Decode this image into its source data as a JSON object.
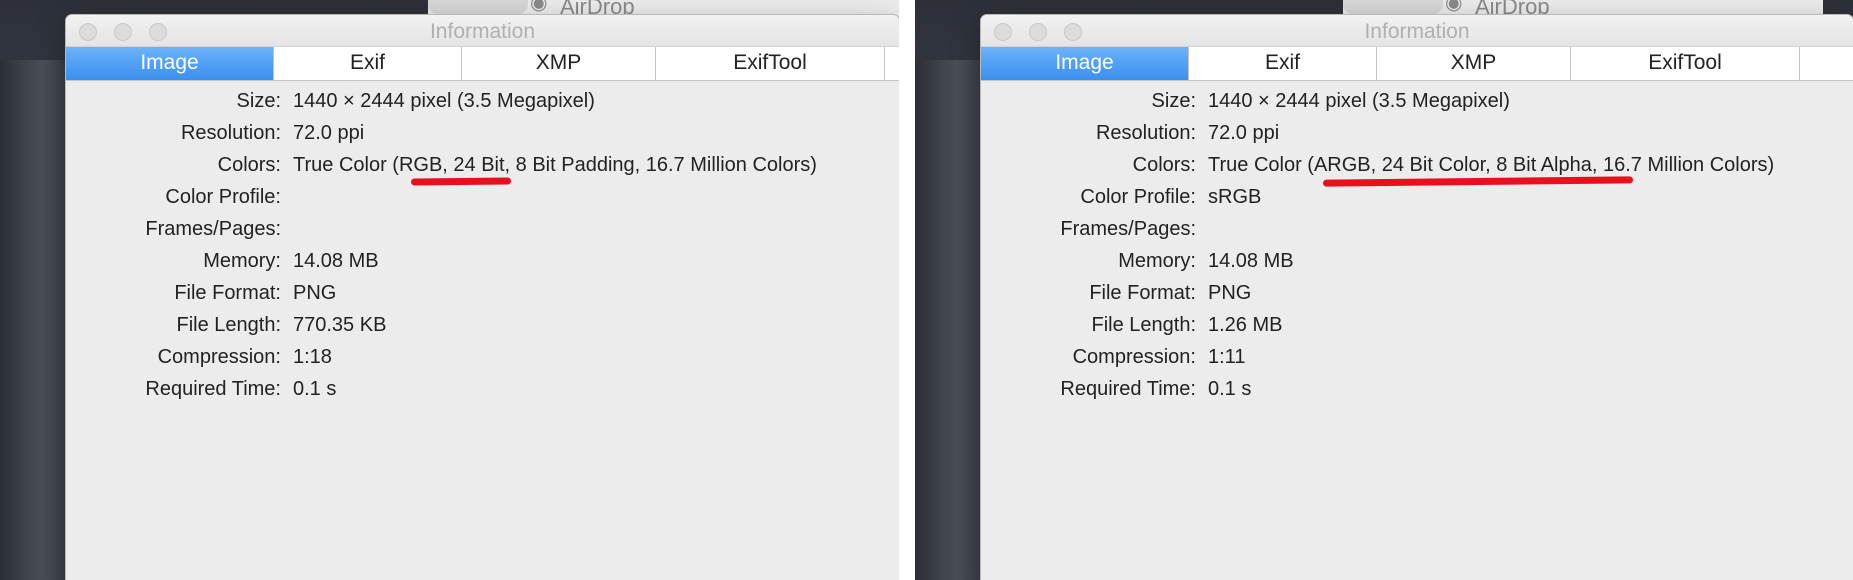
{
  "background": {
    "airdrop_label": "AirDrop"
  },
  "panels": [
    {
      "window": {
        "title": "Information",
        "tabs": [
          "Image",
          "Exif",
          "XMP",
          "ExifTool"
        ],
        "active_tab": "Image",
        "rows": [
          {
            "label": "Size:",
            "value": "1440 × 2444 pixel (3.5 Megapixel)"
          },
          {
            "label": "Resolution:",
            "value": "72.0 ppi"
          },
          {
            "label": "Colors:",
            "value": "True Color (RGB, 24 Bit, 8 Bit Padding, 16.7 Million Colors)"
          },
          {
            "label": "Color Profile:",
            "value": ""
          },
          {
            "label": "Frames/Pages:",
            "value": ""
          },
          {
            "label": "Memory:",
            "value": "14.08 MB"
          },
          {
            "label": "File Format:",
            "value": "PNG"
          },
          {
            "label": "File Length:",
            "value": "770.35 KB"
          },
          {
            "label": "Compression:",
            "value": "1:18"
          },
          {
            "label": "Required Time:",
            "value": "0.1 s"
          }
        ],
        "annotation_color": "#e8101c"
      }
    },
    {
      "window": {
        "title": "Information",
        "tabs": [
          "Image",
          "Exif",
          "XMP",
          "ExifTool"
        ],
        "active_tab": "Image",
        "rows": [
          {
            "label": "Size:",
            "value": "1440 × 2444 pixel (3.5 Megapixel)"
          },
          {
            "label": "Resolution:",
            "value": "72.0 ppi"
          },
          {
            "label": "Colors:",
            "value": "True Color (ARGB, 24 Bit Color, 8 Bit Alpha, 16.7 Million Colors)"
          },
          {
            "label": "Color Profile:",
            "value": "sRGB"
          },
          {
            "label": "Frames/Pages:",
            "value": ""
          },
          {
            "label": "Memory:",
            "value": "14.08 MB"
          },
          {
            "label": "File Format:",
            "value": "PNG"
          },
          {
            "label": "File Length:",
            "value": "1.26 MB"
          },
          {
            "label": "Compression:",
            "value": "1:11"
          },
          {
            "label": "Required Time:",
            "value": "0.1 s"
          }
        ],
        "annotation_color": "#e8101c"
      }
    }
  ]
}
